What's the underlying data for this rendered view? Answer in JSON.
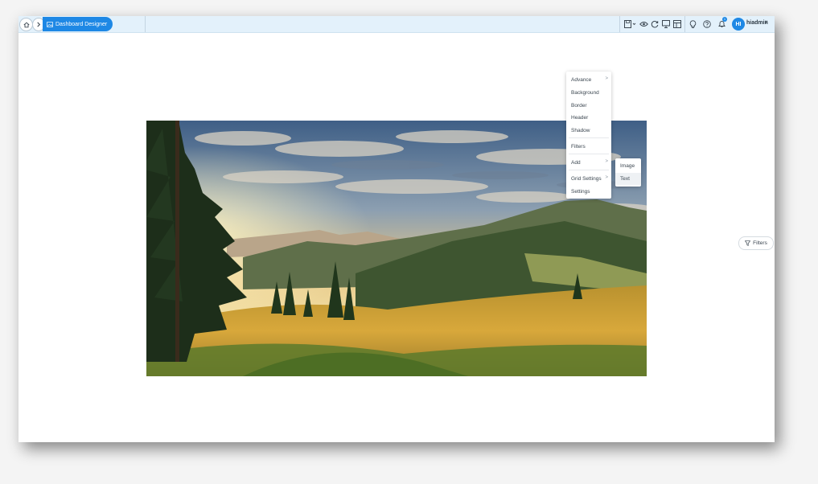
{
  "topbar": {
    "breadcrumb_label": "Dashboard Designer",
    "notification_count": "1",
    "user_initials": "HI",
    "user_name": "hiadmin",
    "user_caret": "v"
  },
  "context_menu": {
    "items": [
      {
        "label": "Advance",
        "has_submenu": true
      },
      {
        "label": "Background",
        "has_submenu": false
      },
      {
        "label": "Border",
        "has_submenu": false
      },
      {
        "label": "Header",
        "has_submenu": false
      },
      {
        "label": "Shadow",
        "has_submenu": false
      },
      {
        "label": "Filters",
        "has_submenu": false
      },
      {
        "label": "Add",
        "has_submenu": true
      },
      {
        "label": "Grid Settings",
        "has_submenu": true
      },
      {
        "label": "Settings",
        "has_submenu": false
      }
    ],
    "submenu_arrow": ">"
  },
  "add_submenu": {
    "items": [
      {
        "label": "Image"
      },
      {
        "label": "Text"
      }
    ]
  },
  "filters_button": {
    "label": "Filters"
  },
  "colors": {
    "accent": "#1e88e5",
    "topbar_bg": "#e3f1fb"
  },
  "icons": [
    "home-icon",
    "chevron-right-icon",
    "image-icon",
    "save-icon",
    "eye-icon",
    "refresh-icon",
    "monitor-icon",
    "layout-icon",
    "lightbulb-icon",
    "help-icon",
    "bell-icon",
    "filter-icon"
  ]
}
